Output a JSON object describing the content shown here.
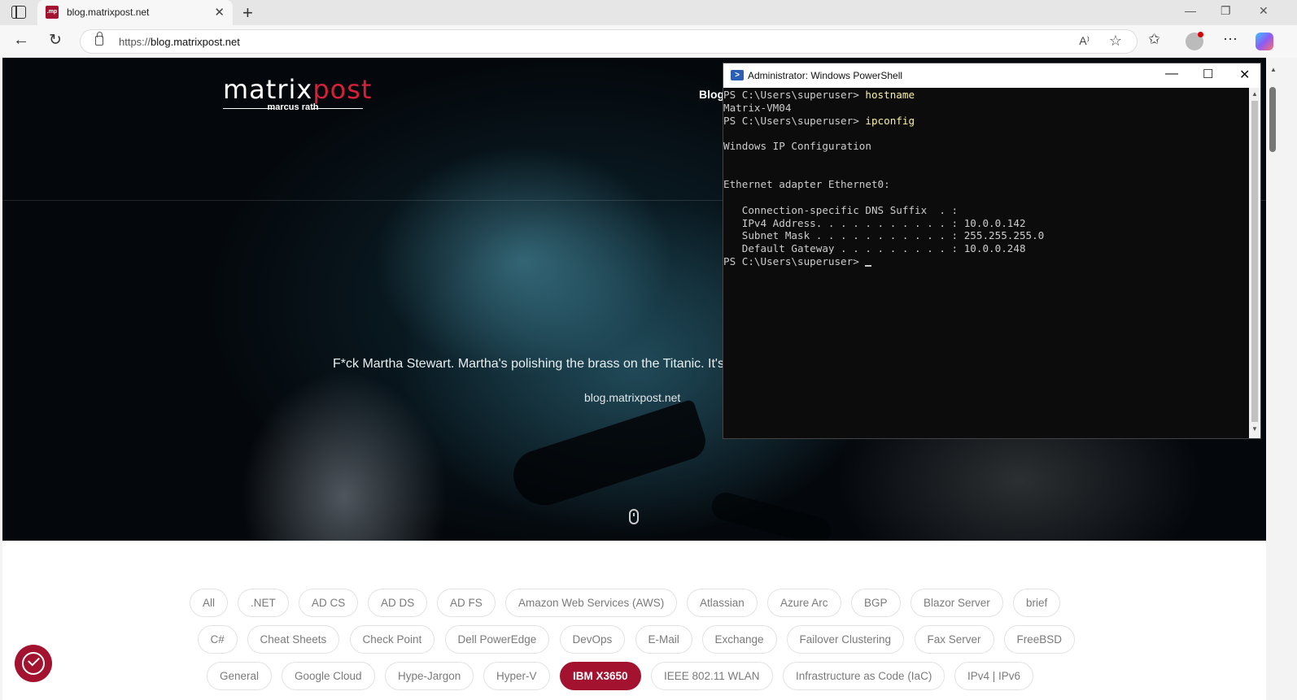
{
  "browser": {
    "tab_title": "blog.matrixpost.net",
    "favicon_text": ".mp",
    "url_scheme": "https://",
    "url_host": "blog.matrixpost.net",
    "read_aloud_label": "A⁾"
  },
  "site": {
    "logo_part1": "matrix",
    "logo_part2": "post",
    "logo_subtitle": "marcus rath",
    "nav_blog": "Blog",
    "hero_quote": "F*ck Martha Stewart. Martha's polishing the brass on the Titanic. It's",
    "hero_site": "blog.matrixpost.net"
  },
  "tags": {
    "row1": [
      "All",
      ".NET",
      "AD CS",
      "AD DS",
      "AD FS",
      "Amazon Web Services (AWS)",
      "Atlassian",
      "Azure Arc",
      "BGP",
      "Blazor Server",
      "brief"
    ],
    "row2": [
      "C#",
      "Cheat Sheets",
      "Check Point",
      "Dell PowerEdge",
      "DevOps",
      "E-Mail",
      "Exchange",
      "Failover Clustering",
      "Fax Server",
      "FreeBSD"
    ],
    "row3": [
      "General",
      "Google Cloud",
      "Hype-Jargon",
      "Hyper-V",
      "IBM X3650",
      "IEEE 802.11 WLAN",
      "Infrastructure as Code (IaC)",
      "IPv4 | IPv6"
    ],
    "active": "IBM X3650"
  },
  "powershell": {
    "title": "Administrator: Windows PowerShell",
    "lines": [
      {
        "prompt": "PS C:\\Users\\superuser> ",
        "cmd": "hostname"
      },
      {
        "out": "Matrix-VM04"
      },
      {
        "prompt": "PS C:\\Users\\superuser> ",
        "cmd": "ipconfig"
      },
      {
        "out": ""
      },
      {
        "out": "Windows IP Configuration"
      },
      {
        "out": ""
      },
      {
        "out": ""
      },
      {
        "out": "Ethernet adapter Ethernet0:"
      },
      {
        "out": ""
      },
      {
        "out": "   Connection-specific DNS Suffix  . :"
      },
      {
        "out": "   IPv4 Address. . . . . . . . . . . : 10.0.0.142"
      },
      {
        "out": "   Subnet Mask . . . . . . . . . . . : 255.255.255.0"
      },
      {
        "out": "   Default Gateway . . . . . . . . . : 10.0.0.248"
      },
      {
        "prompt": "PS C:\\Users\\superuser> ",
        "cmd": "",
        "cursor": true
      }
    ]
  },
  "colors": {
    "brand_red": "#a3132f",
    "console_bg": "#0c0c0c",
    "console_cmd": "#f9f1a5"
  }
}
